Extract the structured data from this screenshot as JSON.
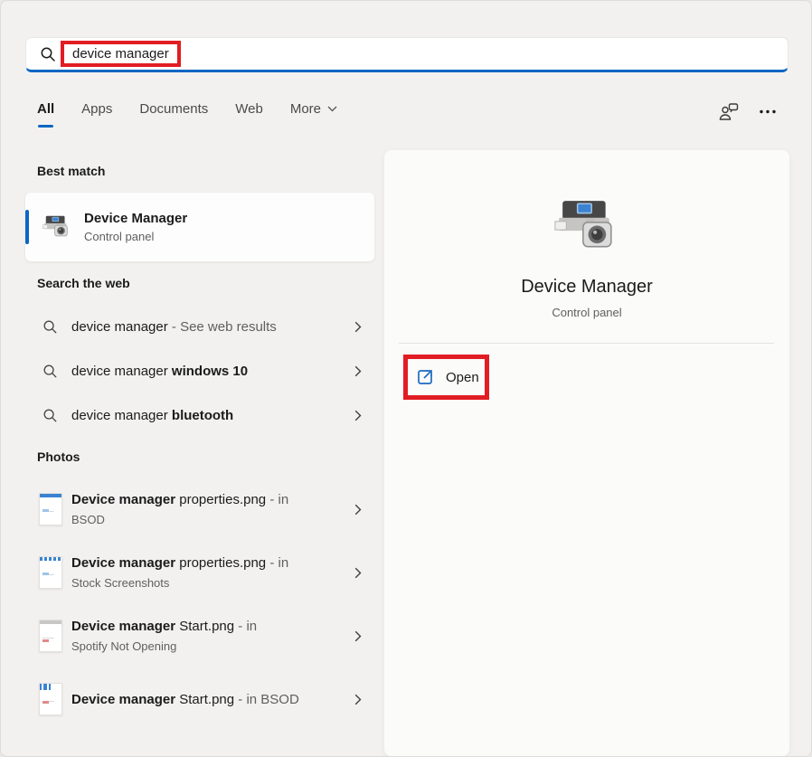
{
  "colors": {
    "accent": "#0b66c3",
    "annotation_red": "#e11d23"
  },
  "search_bar": {
    "query": "device manager",
    "icon": "search-icon"
  },
  "tabs": [
    {
      "label": "All",
      "active": true
    },
    {
      "label": "Apps",
      "active": false
    },
    {
      "label": "Documents",
      "active": false
    },
    {
      "label": "Web",
      "active": false
    },
    {
      "label": "More",
      "active": false,
      "has_chevron": true
    }
  ],
  "top_actions": {
    "icons": [
      "feedback-icon",
      "more-options-icon"
    ]
  },
  "sections": {
    "best_match": {
      "heading": "Best match",
      "item": {
        "title": "Device Manager",
        "subtitle": "Control panel",
        "icon": "device-manager-icon"
      }
    },
    "web": {
      "heading": "Search the web",
      "items": [
        {
          "query": "device manager",
          "muted": " - See web results"
        },
        {
          "query": "device manager ",
          "bold": "windows 10"
        },
        {
          "query": "device manager ",
          "bold": "bluetooth"
        }
      ]
    },
    "photos": {
      "heading": "Photos",
      "items": [
        {
          "bold": "Device manager",
          "name": " properties.png",
          "muted": " - in",
          "location": "BSOD"
        },
        {
          "bold": "Device manager",
          "name": " properties.png",
          "muted": " - in",
          "location": "Stock Screenshots"
        },
        {
          "bold": "Device manager",
          "name": " Start.png",
          "muted": " - in",
          "location": "Spotify Not Opening"
        },
        {
          "bold": "Device manager",
          "name": " Start.png",
          "muted": " - in BSOD"
        }
      ]
    }
  },
  "preview": {
    "title": "Device Manager",
    "subtitle": "Control panel",
    "open_label": "Open",
    "icon": "device-manager-icon",
    "open_icon": "external-link-icon"
  }
}
